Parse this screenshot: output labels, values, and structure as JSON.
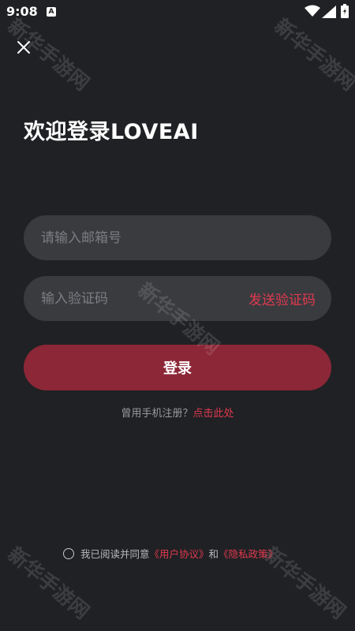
{
  "status_bar": {
    "time": "9:08",
    "notification_icon": "a-icon",
    "notification_glyph": "A",
    "icons": [
      "wifi-icon",
      "signal-icon",
      "battery-charging-icon"
    ]
  },
  "close_icon": "close-icon",
  "title": "欢迎登录LOVEAI",
  "email": {
    "placeholder": "请输入邮箱号",
    "value": ""
  },
  "code": {
    "placeholder": "输入验证码",
    "value": "",
    "send_label": "发送验证码"
  },
  "login_label": "登录",
  "register": {
    "prompt": "曾用手机注册？",
    "link": "点击此处"
  },
  "agreement": {
    "checked": false,
    "prefix": "我已阅读并同意",
    "user_agreement": "《用户协议》",
    "conjunction": "和",
    "privacy_policy": "《隐私政策》"
  },
  "watermark_text": "新华手游网",
  "colors": {
    "background": "#202124",
    "field": "#3a3b3f",
    "accent": "#e0394f",
    "button": "#8c2737"
  }
}
